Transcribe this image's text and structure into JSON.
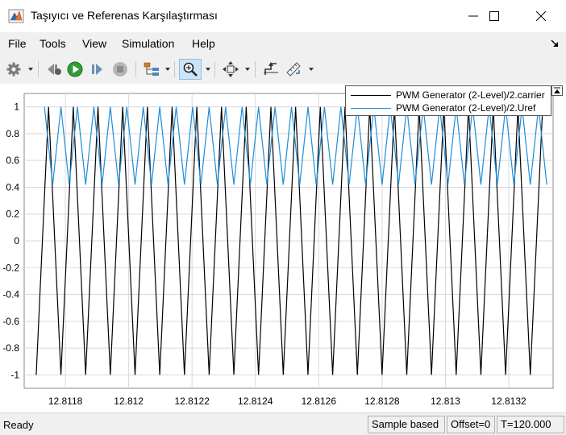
{
  "window": {
    "title": "Taşıyıcı ve Referenas Karşılaştırması"
  },
  "menu": {
    "items": [
      "File",
      "Tools",
      "View",
      "Simulation",
      "Help"
    ]
  },
  "toolbar": {
    "icons": [
      "gear-icon",
      "step-back-icon",
      "run-icon",
      "step-forward-icon",
      "stop-icon",
      "signal-hierarchy-icon",
      "zoom-icon",
      "fit-to-view-icon",
      "cursor-measure-icon",
      "triggers-icon"
    ],
    "zoom_active": true
  },
  "legend": {
    "entries": [
      {
        "label": "PWM Generator (2-Level)/2.carrier",
        "color": "#000000"
      },
      {
        "label": "PWM Generator (2-Level)/2.Uref",
        "color": "#1f8dd6"
      }
    ]
  },
  "chart_data": {
    "type": "line",
    "x_ticks": [
      "12.8118",
      "12.812",
      "12.8122",
      "12.8124",
      "12.8126",
      "12.8128",
      "12.813",
      "12.8132"
    ],
    "y_ticks": [
      "1",
      "0.8",
      "0.6",
      "0.4",
      "0.2",
      "0",
      "-0.2",
      "-0.4",
      "-0.6",
      "-0.8",
      "-1"
    ],
    "xlim": [
      12.81167,
      12.81334
    ],
    "ylim": [
      -1.1,
      1.1
    ],
    "grid": true,
    "legend_position": "top-right",
    "series": [
      {
        "name": "PWM Generator (2-Level)/2.carrier",
        "color": "#000000",
        "waveform": "triangle",
        "min": -1,
        "max": 1,
        "peak_x": [
          12.811747,
          12.811825,
          12.811903,
          12.811981,
          12.812059,
          12.812137,
          12.812215,
          12.812293,
          12.812371,
          12.812449,
          12.812527,
          12.812605,
          12.812683,
          12.812761,
          12.812839,
          12.812917,
          12.812995,
          12.813073,
          12.813151,
          12.813229,
          12.813307
        ],
        "trough_x": [
          12.811708,
          12.811786,
          12.811864,
          12.811942,
          12.81202,
          12.812098,
          12.812176,
          12.812254,
          12.812332,
          12.81241,
          12.812488,
          12.812566,
          12.812644,
          12.812722,
          12.8128,
          12.812878,
          12.812956,
          12.813034,
          12.813112,
          12.81319,
          12.813268
        ]
      },
      {
        "name": "PWM Generator (2-Level)/2.Uref",
        "color": "#1f8dd6",
        "waveform": "triangle",
        "min": 0.42,
        "max": 1,
        "peak_x": [
          12.811734,
          12.811786,
          12.811838,
          12.81189,
          12.811942,
          12.811994,
          12.812046,
          12.812098,
          12.81215,
          12.812202,
          12.812254,
          12.812306,
          12.812358,
          12.81241,
          12.812462,
          12.812514,
          12.812566,
          12.812618,
          12.81267,
          12.812722,
          12.812774,
          12.812826,
          12.812878,
          12.81293,
          12.812982,
          12.813034,
          12.813086,
          12.813138,
          12.81319,
          12.813242,
          12.813294
        ],
        "trough_x": [
          12.81176,
          12.811812,
          12.811864,
          12.811916,
          12.811968,
          12.81202,
          12.812072,
          12.812124,
          12.812176,
          12.812228,
          12.81228,
          12.812332,
          12.812384,
          12.812436,
          12.812488,
          12.81254,
          12.812592,
          12.812644,
          12.812696,
          12.812748,
          12.8128,
          12.812852,
          12.812904,
          12.812956,
          12.813008,
          12.81306,
          12.813112,
          12.813164,
          12.813216,
          12.813268,
          12.81332
        ]
      }
    ]
  },
  "status": {
    "text": "Ready",
    "mode": "Sample based",
    "offset": "Offset=0",
    "time": "T=120.000"
  }
}
